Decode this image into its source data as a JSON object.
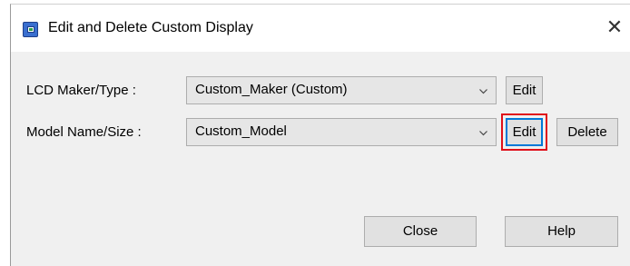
{
  "window": {
    "title": "Edit and Delete Custom Display",
    "icon": "app-window-icon",
    "close_glyph": "✕"
  },
  "rows": {
    "lcd": {
      "label": "LCD Maker/Type :",
      "selected": "Custom_Maker (Custom)",
      "edit_label": "Edit"
    },
    "model": {
      "label": "Model Name/Size :",
      "selected": "Custom_Model",
      "edit_label": "Edit",
      "delete_label": "Delete"
    }
  },
  "footer": {
    "close_label": "Close",
    "help_label": "Help"
  },
  "colors": {
    "focus_border": "#0078d7",
    "highlight_border": "#e0101a",
    "dialog_bg": "#f0f0f0"
  }
}
